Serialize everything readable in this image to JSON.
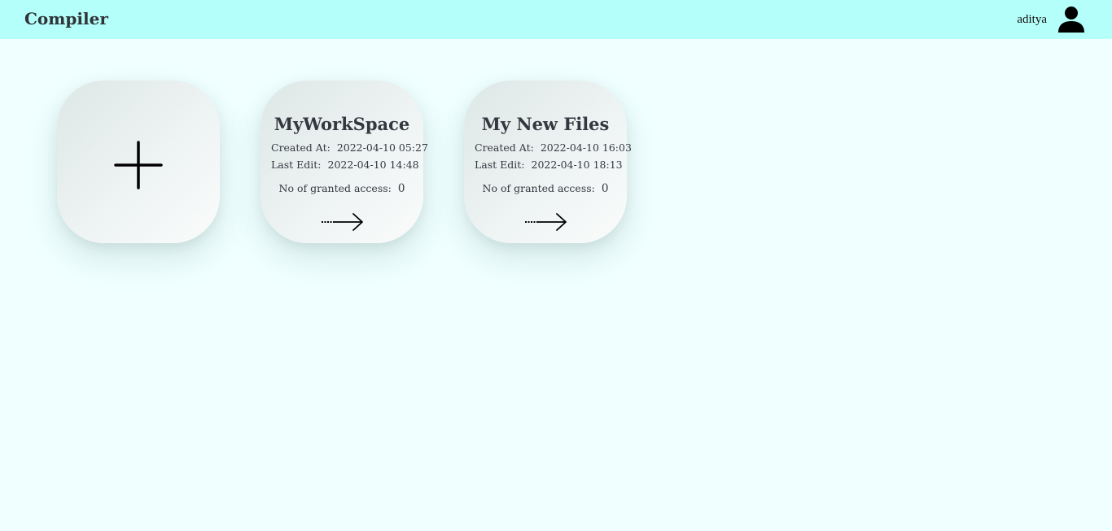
{
  "navbar": {
    "brand": "Compiler",
    "user": {
      "name": "aditya",
      "icon": "user-icon"
    },
    "background_color": "#b4fff9"
  },
  "page": {
    "background_color": "#f0ffff"
  },
  "add_card": {
    "icon": "plus-icon"
  },
  "workspaces": [
    {
      "title": "MyWorkSpace",
      "created_label": "Created At:",
      "created_value": "2022-04-10 05:27",
      "edited_label": "Last Edit:",
      "edited_value": "2022-04-10 14:48",
      "access_label": "No of granted access:",
      "access_value": "0",
      "open_icon": "dotted-arrow-right-icon"
    },
    {
      "title": "My New Files",
      "created_label": "Created At:",
      "created_value": "2022-04-10 16:03",
      "edited_label": "Last Edit:",
      "edited_value": "2022-04-10 18:13",
      "access_label": "No of granted access:",
      "access_value": "0",
      "open_icon": "dotted-arrow-right-icon"
    }
  ]
}
